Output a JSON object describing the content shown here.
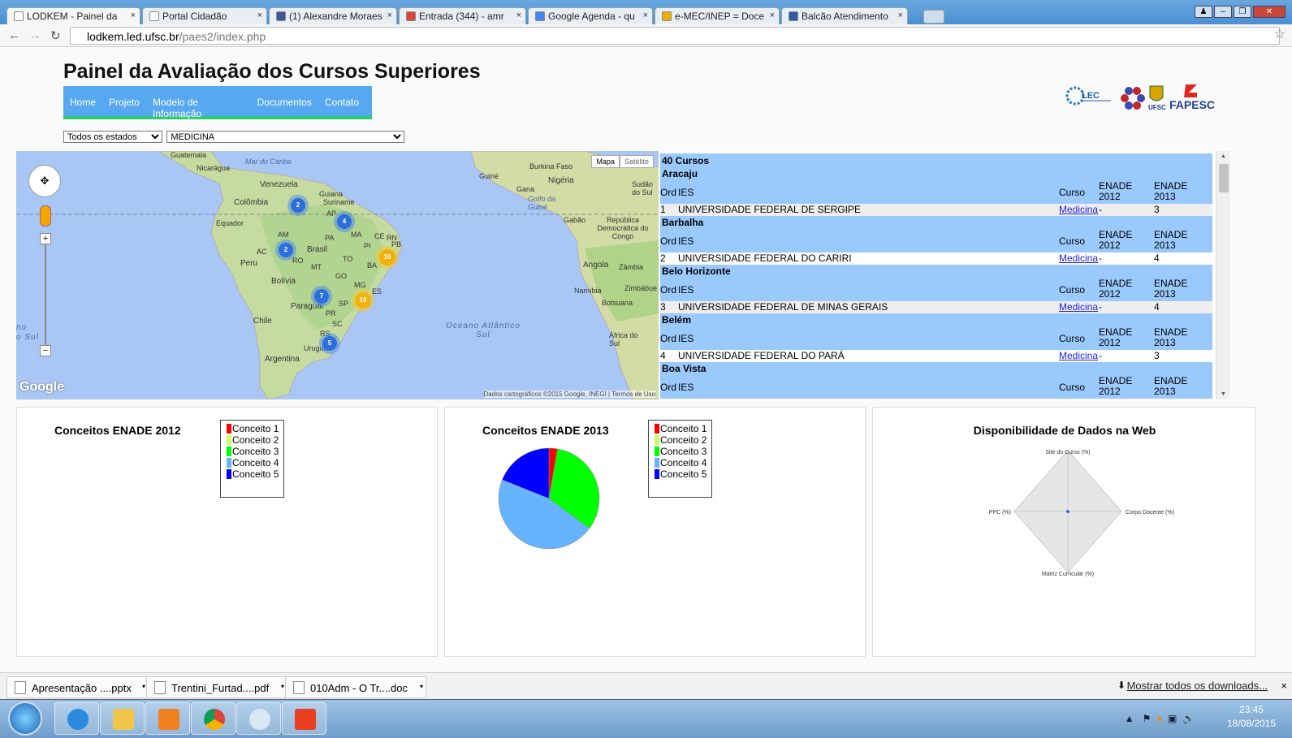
{
  "browser": {
    "tabs": [
      {
        "label": "LODKEM - Painel da",
        "color": "#ffffff",
        "active": true
      },
      {
        "label": "Portal Cidadão",
        "color": "#ffffff",
        "active": false
      },
      {
        "label": "(1) Alexandre Moraes",
        "color": "#3b5998",
        "active": false
      },
      {
        "label": "Entrada (344) - amr",
        "color": "#db4437",
        "active": false
      },
      {
        "label": "Google Agenda - qu",
        "color": "#4285f4",
        "active": false
      },
      {
        "label": "e-MEC/INEP = Doce",
        "color": "#f0b000",
        "active": false
      },
      {
        "label": "Balcão Atendimento",
        "color": "#2a5aa8",
        "active": false
      }
    ],
    "url_host": "lodkem.led.ufsc.br",
    "url_path": "/paes2/index.php"
  },
  "page": {
    "title": "Painel da Avaliação dos Cursos Superiores",
    "menu": [
      "Home",
      "Projeto",
      "Modelo de Informação",
      "Documentos",
      "Contato"
    ],
    "logos": [
      "LEC",
      "UFSC",
      "FAPESC"
    ],
    "state_select": "Todos os estados",
    "course_select": "MEDICINA"
  },
  "map": {
    "type_buttons": [
      "Mapa",
      "Satélite"
    ],
    "footer": "Dados cartográficos ©2015 Google, INEGI | Termos de Uso",
    "logo": "Google",
    "labels": [
      "Guatemala",
      "Nicarágua",
      "Mar do Caribe",
      "Venezuela",
      "Guiana",
      "Suriname",
      "Colômbia",
      "Equador",
      "AP",
      "AM",
      "PA",
      "MA",
      "CE",
      "RN",
      "PB",
      "PI",
      "AC",
      "Brasil",
      "Peru",
      "RO",
      "TO",
      "BA",
      "MT",
      "GO",
      "Bolívia",
      "MG",
      "ES",
      "Paraguai",
      "SP",
      "PR",
      "Chile",
      "SC",
      "RS",
      "Uruguai",
      "Argentina",
      "Burkina Faso",
      "Guiné",
      "Gana",
      "Nigéria",
      "Sudão do Sul",
      "Golfo da Guiné",
      "Gabão",
      "República Democrática do Congo",
      "Angola",
      "Zâmbia",
      "Namíbia",
      "Zimbábue",
      "Botsuana",
      "África do Sul",
      "Oceano Atlântico Sul",
      "no",
      "o Sul"
    ],
    "clusters": [
      {
        "count": "2",
        "color": "blue"
      },
      {
        "count": "4",
        "color": "blue"
      },
      {
        "count": "2",
        "color": "blue"
      },
      {
        "count": "10",
        "color": "yel"
      },
      {
        "count": "7",
        "color": "blue"
      },
      {
        "count": "10",
        "color": "yel"
      },
      {
        "count": "5",
        "color": "blue"
      }
    ]
  },
  "courses": {
    "total": "40 Cursos",
    "col_ord": "Ord",
    "col_ies": "IES",
    "col_curso": "Curso",
    "col_enade_2012": "ENADE 2012",
    "col_enade_2013": "ENADE 2013",
    "groups": [
      {
        "city": "Aracaju",
        "ord": "1",
        "ies": "UNIVERSIDADE FEDERAL DE SERGIPE",
        "curso": "Medicina",
        "e2012": "-",
        "e2013": "3"
      },
      {
        "city": "Barbalha",
        "ord": "2",
        "ies": "UNIVERSIDADE FEDERAL DO CARIRI",
        "curso": "Medicina",
        "e2012": "-",
        "e2013": "4"
      },
      {
        "city": "Belo Horizonte",
        "ord": "3",
        "ies": "UNIVERSIDADE FEDERAL DE MINAS GERAIS",
        "curso": "Medicina",
        "e2012": "-",
        "e2013": "4"
      },
      {
        "city": "Belém",
        "ord": "4",
        "ies": "UNIVERSIDADE FEDERAL DO PARÁ",
        "curso": "Medicina",
        "e2012": "-",
        "e2013": "3"
      },
      {
        "city": "Boa Vista"
      }
    ]
  },
  "charts": {
    "enade2012_title": "Conceitos ENADE 2012",
    "enade2013_title": "Conceitos ENADE 2013",
    "web_title": "Disponibilidade de Dados na Web",
    "legend": [
      {
        "label": "Conceito 1",
        "color": "#ff0000"
      },
      {
        "label": "Conceito 2",
        "color": "#ccff66"
      },
      {
        "label": "Conceito 3",
        "color": "#00ff00"
      },
      {
        "label": "Conceito 4",
        "color": "#66b3ff"
      },
      {
        "label": "Conceito 5",
        "color": "#0000ff"
      }
    ],
    "radar_axes": [
      "Site do Curso (%)",
      "Corpo Docente (%)",
      "Matriz Curricular (%)",
      "PPC (%)"
    ]
  },
  "chart_data": [
    {
      "type": "pie",
      "title": "Conceitos ENADE 2012",
      "categories": [
        "Conceito 1",
        "Conceito 2",
        "Conceito 3",
        "Conceito 4",
        "Conceito 5"
      ],
      "values": []
    },
    {
      "type": "pie",
      "title": "Conceitos ENADE 2013",
      "categories": [
        "Conceito 1",
        "Conceito 2",
        "Conceito 3",
        "Conceito 4",
        "Conceito 5"
      ],
      "values": [
        1,
        0,
        12,
        17,
        7
      ]
    },
    {
      "type": "radar",
      "title": "Disponibilidade de Dados na Web",
      "categories": [
        "Site do Curso (%)",
        "Corpo Docente (%)",
        "Matriz Curricular (%)",
        "PPC (%)"
      ],
      "values": [
        0,
        0,
        0,
        0
      ]
    }
  ],
  "downloads": {
    "items": [
      "Apresentação ....pptx",
      "Trentini_Furtad....pdf",
      "010Adm - O Tr....doc"
    ],
    "show_all": "Mostrar todos os downloads..."
  },
  "taskbar": {
    "time": "23:45",
    "date": "18/08/2015"
  }
}
